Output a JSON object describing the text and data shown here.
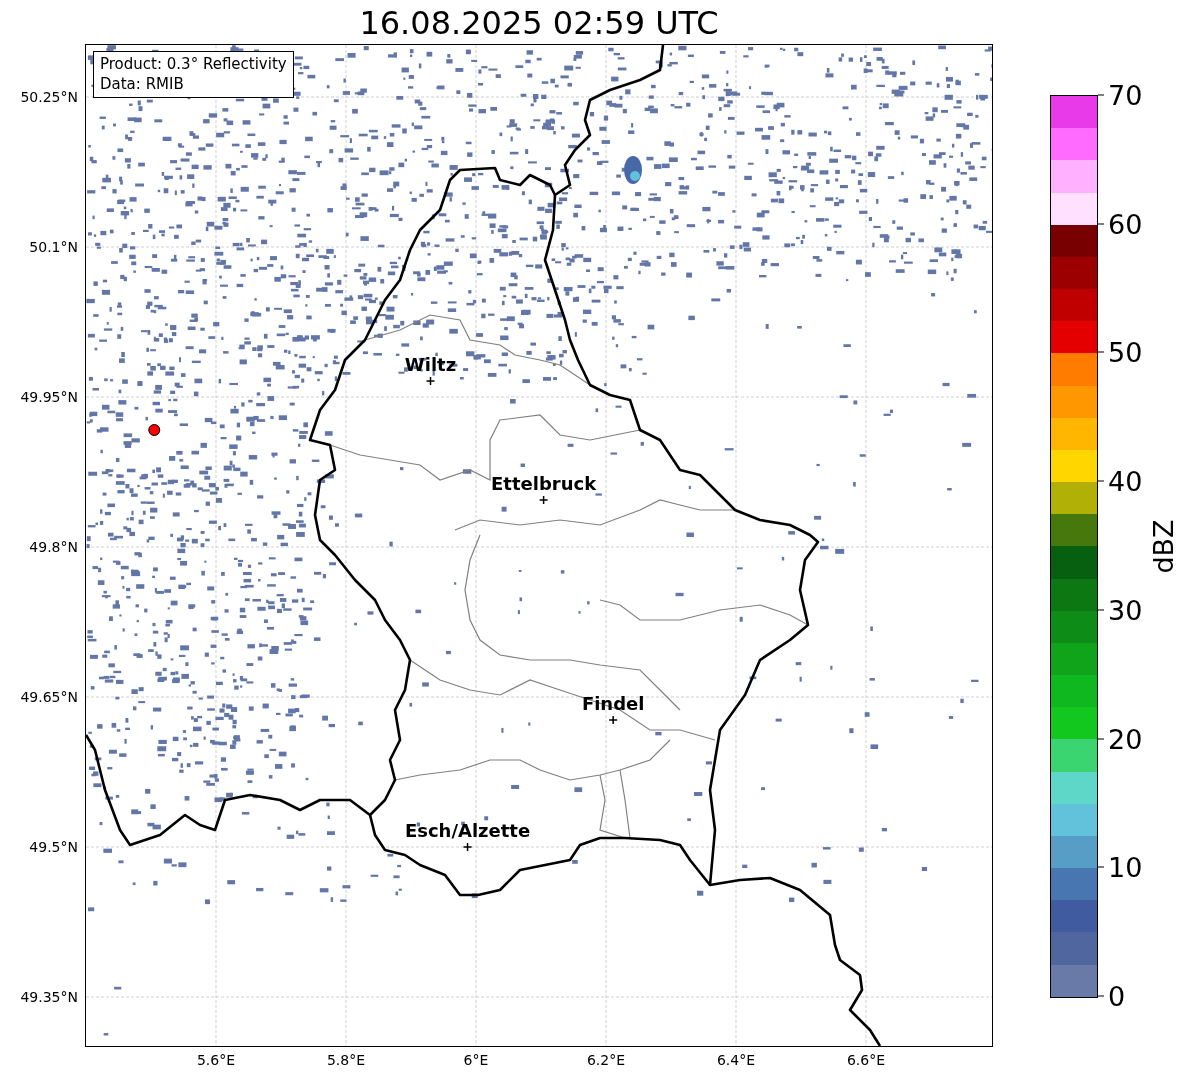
{
  "title": "16.08.2025 02:59 UTC",
  "legend": [
    "Product: 0.3° Reflectivity",
    "Data: RMIB"
  ],
  "y_ticks": [
    "50.25°N",
    "50.1°N",
    "49.95°N",
    "49.8°N",
    "49.65°N",
    "49.5°N",
    "49.35°N"
  ],
  "x_ticks": [
    "5.6°E",
    "5.8°E",
    "6°E",
    "6.2°E",
    "6.4°E",
    "6.6°E"
  ],
  "cities": [
    {
      "name": "Wiltz"
    },
    {
      "name": "Ettelbruck"
    },
    {
      "name": "Findel"
    },
    {
      "name": "Esch/Alzette"
    }
  ],
  "colorbar": {
    "label": "dBZ",
    "ticks": [
      "70",
      "60",
      "50",
      "40",
      "30",
      "20",
      "10",
      "0"
    ]
  }
}
